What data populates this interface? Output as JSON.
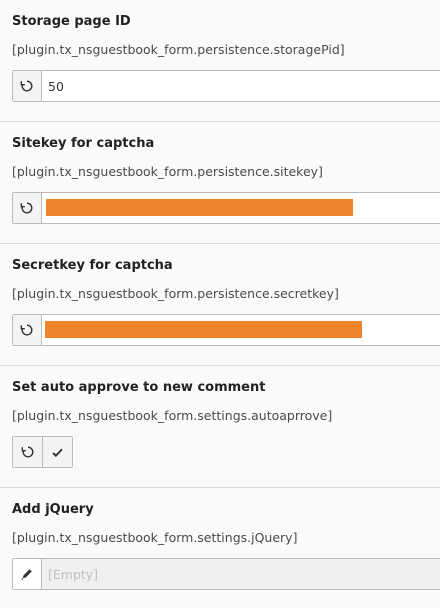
{
  "fields": [
    {
      "label": "Storage page ID",
      "path": "[plugin.tx_nsguestbook_form.persistence.storagePid]",
      "value": "50",
      "action_icon": "reset-icon"
    },
    {
      "label": "Sitekey for captcha",
      "path": "[plugin.tx_nsguestbook_form.persistence.sitekey]",
      "redacted": true,
      "action_icon": "reset-icon"
    },
    {
      "label": "Secretkey for captcha",
      "path": "[plugin.tx_nsguestbook_form.persistence.secretkey]",
      "redacted": true,
      "action_icon": "reset-icon"
    },
    {
      "label": "Set auto approve to new comment",
      "path": "[plugin.tx_nsguestbook_form.settings.autoaprrove]",
      "type": "checkbox",
      "checked": true,
      "action_icon": "reset-icon",
      "check_icon": "checkmark-icon"
    },
    {
      "label": "Add jQuery",
      "path": "[plugin.tx_nsguestbook_form.settings.jQuery]",
      "placeholder": "[Empty]",
      "action_icon": "pencil-icon"
    }
  ],
  "colors": {
    "redaction": "#ee842b",
    "background": "#fafafa",
    "border": "#bbbbbb"
  }
}
